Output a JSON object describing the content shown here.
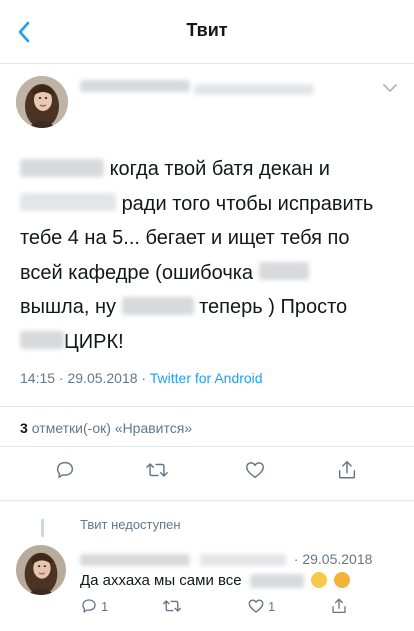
{
  "header": {
    "title": "Твит"
  },
  "tweet": {
    "text_parts": {
      "l1": "когда твой батя декан и",
      "l2": "ради того чтобы исправить",
      "l3": "тебе 4 на 5... бегает и ищет тебя по",
      "l4": "всей кафедре (ошибочка",
      "l5a": "вышла, ну",
      "l5b": "теперь ) Просто",
      "l6": "ЦИРК!"
    },
    "time": "14:15 · 29.05.2018 ·",
    "source": "Twitter for Android",
    "likes_count": "3",
    "likes_label": "отметки(-ок) «Нравится»"
  },
  "reply": {
    "unavailable": "Твит недоступен",
    "date": "· 29.05.2018",
    "text": "Да аххаха мы сами все",
    "reply_count": "1",
    "like_count": "1"
  },
  "icons": {
    "back": "chevron-left-icon",
    "menu": "chevron-down-icon",
    "reply": "comment-icon",
    "retweet": "retweet-icon",
    "like": "heart-icon",
    "share": "share-icon"
  },
  "colors": {
    "accent": "#1da1f2",
    "secondary_text": "#657786",
    "divider": "#e1e8ed"
  }
}
